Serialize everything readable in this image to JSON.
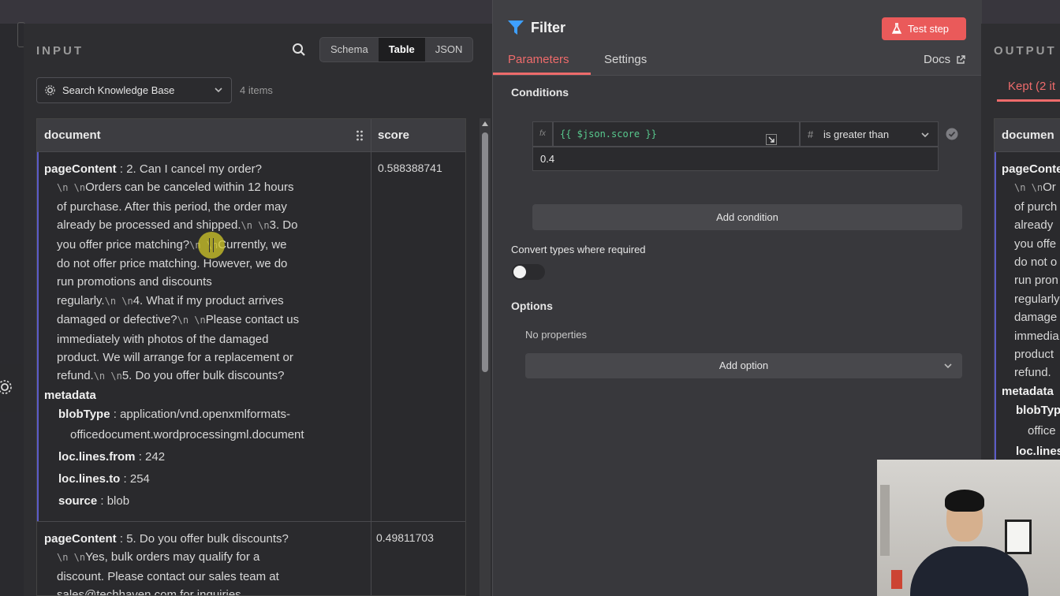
{
  "input": {
    "label": "INPUT",
    "view_tabs": [
      "Schema",
      "Table",
      "JSON"
    ],
    "active_view": "Table",
    "node_select": "Search Knowledge Base",
    "items_count": "4 items",
    "columns": [
      "document",
      "score"
    ],
    "rows": [
      {
        "score": "0.588388741",
        "pageContent_key": "pageContent",
        "pageContent_first": "2. Can I cancel my order?",
        "nl": "\\n \\n",
        "lines": [
          [
            "",
            "Orders can be canceled within 12 hours"
          ],
          [
            "",
            "of purchase. After this period, the order may"
          ],
          [
            "",
            "already be processed and shipped."
          ],
          [
            "",
            "you offer price matching?"
          ],
          [
            "",
            "do not offer price matching. However, we do"
          ],
          [
            "",
            "run promotions and discounts"
          ],
          [
            "",
            "regularly."
          ],
          [
            "",
            "damaged or defective?"
          ],
          [
            "",
            "immediately with photos of the damaged"
          ],
          [
            "",
            "product. We will arrange for a replacement or"
          ],
          [
            "",
            "refund."
          ]
        ],
        "seg_3": "3. Do",
        "seg_currently": "Currently, we",
        "seg_4": "4. What if my product arrives",
        "seg_please": "Please contact us",
        "seg_5": "5. Do you offer bulk discounts?",
        "metadata_key": "metadata",
        "blobType_key": "blobType",
        "blobType_val1": "application/vnd.openxmlformats-",
        "blobType_val2": "officedocument.wordprocessingml.document",
        "from_key": "loc.lines.from",
        "from_val": "242",
        "to_key": "loc.lines.to",
        "to_val": "254",
        "source_key": "source",
        "source_val": "blob"
      },
      {
        "score": "0.49811703",
        "pageContent_key": "pageContent",
        "pageContent_first": "5. Do you offer bulk discounts?",
        "line1": "Yes, bulk orders may qualify for a",
        "line2": "discount. Please contact our sales team at",
        "line3": "sales@techhaven.com for inquiries."
      }
    ]
  },
  "filter": {
    "title": "Filter",
    "test_button": "Test step",
    "tabs": [
      "Parameters",
      "Settings"
    ],
    "docs": "Docs",
    "conditions_label": "Conditions",
    "fx": "fx",
    "expression": "{{ $json.score }}",
    "operator_type": "#",
    "operator": "is greater than",
    "value": "0.4",
    "add_condition": "Add condition",
    "convert_label": "Convert types where required",
    "convert_enabled": false,
    "options_label": "Options",
    "no_properties": "No properties",
    "add_option": "Add option"
  },
  "output": {
    "label": "OUTPUT",
    "tab": "Kept (2 it",
    "column": "documen",
    "pc": "pageConte",
    "lines": [
      "Or",
      "of purch",
      "already",
      "you offe",
      "do not o",
      "run pron",
      "regularly",
      "damage",
      "immedia",
      "product",
      "refund."
    ],
    "meta": "metadata",
    "blob": "blobTyp",
    "office": "office",
    "loc": "loc.lines"
  },
  "colors": {
    "accent": "#ee6b6b",
    "test_button": "#ea5a5a",
    "row_highlight": "#5b5bc8",
    "expression": "#58c98e",
    "filter_icon": "#3ea0ff"
  }
}
